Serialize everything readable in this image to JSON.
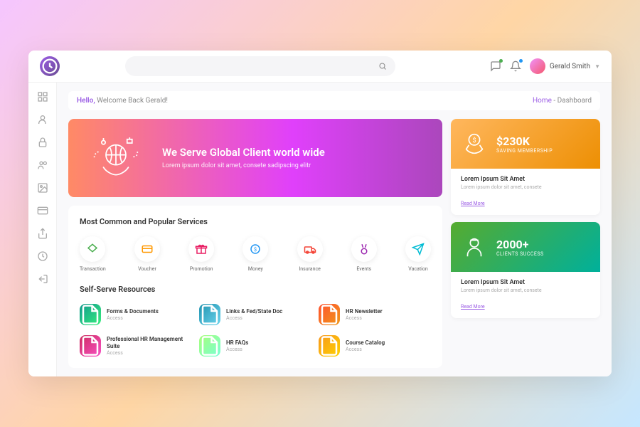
{
  "user": {
    "name": "Gerald Smith"
  },
  "greeting": {
    "hello": "Hello,",
    "welcome": "Welcome Back Gerald!"
  },
  "breadcrumb": {
    "home": "Home",
    "sep": " - ",
    "current": "Dashboard"
  },
  "hero": {
    "title": "We Serve Global Client world wide",
    "subtitle": "Lorem ipsum dolor sit amet, consete sadipscing elitr"
  },
  "services": {
    "title": "Most Common and Popular Services",
    "items": [
      {
        "label": "Transaction",
        "color": "#4caf50"
      },
      {
        "label": "Voucher",
        "color": "#ff9800"
      },
      {
        "label": "Promotion",
        "color": "#e91e63"
      },
      {
        "label": "Money",
        "color": "#2196f3"
      },
      {
        "label": "Insurance",
        "color": "#f44336"
      },
      {
        "label": "Events",
        "color": "#9c27b0"
      },
      {
        "label": "Vacation",
        "color": "#00bcd4"
      }
    ]
  },
  "resources": {
    "title": "Self-Serve Resources",
    "items": [
      {
        "title": "Forms & Documents",
        "sub": "Access",
        "gradient": "linear-gradient(135deg,#11998e,#38ef7d)"
      },
      {
        "title": "Links & Fed/State Doc",
        "sub": "Access",
        "gradient": "linear-gradient(135deg,#2193b0,#6dd5ed)"
      },
      {
        "title": "HR Newsletter",
        "sub": "Access",
        "gradient": "linear-gradient(135deg,#ff512f,#f09819)"
      },
      {
        "title": "Professional HR Management Suite",
        "sub": "Access",
        "gradient": "linear-gradient(135deg,#cc2b5e,#f953c6)"
      },
      {
        "title": "HR FAQs",
        "sub": "Access",
        "gradient": "linear-gradient(135deg,#a8ff78,#78ffd6)"
      },
      {
        "title": "Course Catalog",
        "sub": "Access",
        "gradient": "linear-gradient(135deg,#f7971e,#ffd200)"
      }
    ]
  },
  "stats": [
    {
      "value": "$230K",
      "label": "SAVING MEMBERSHIP",
      "title": "Lorem Ipsum Sit Amet",
      "desc": "Lorem ipsum dolor sit amet, consete",
      "link": "Read More"
    },
    {
      "value": "2000+",
      "label": "CLIENTS SUCCESS",
      "title": "Lorem Ipsum Sit Amet",
      "desc": "Lorem ipsum dolor sit amet, consete",
      "link": "Read More"
    }
  ],
  "sidebar_icons": [
    "grid-icon",
    "user-icon",
    "lock-icon",
    "users-icon",
    "image-icon",
    "card-icon",
    "share-icon",
    "clock-icon",
    "logout-icon"
  ]
}
